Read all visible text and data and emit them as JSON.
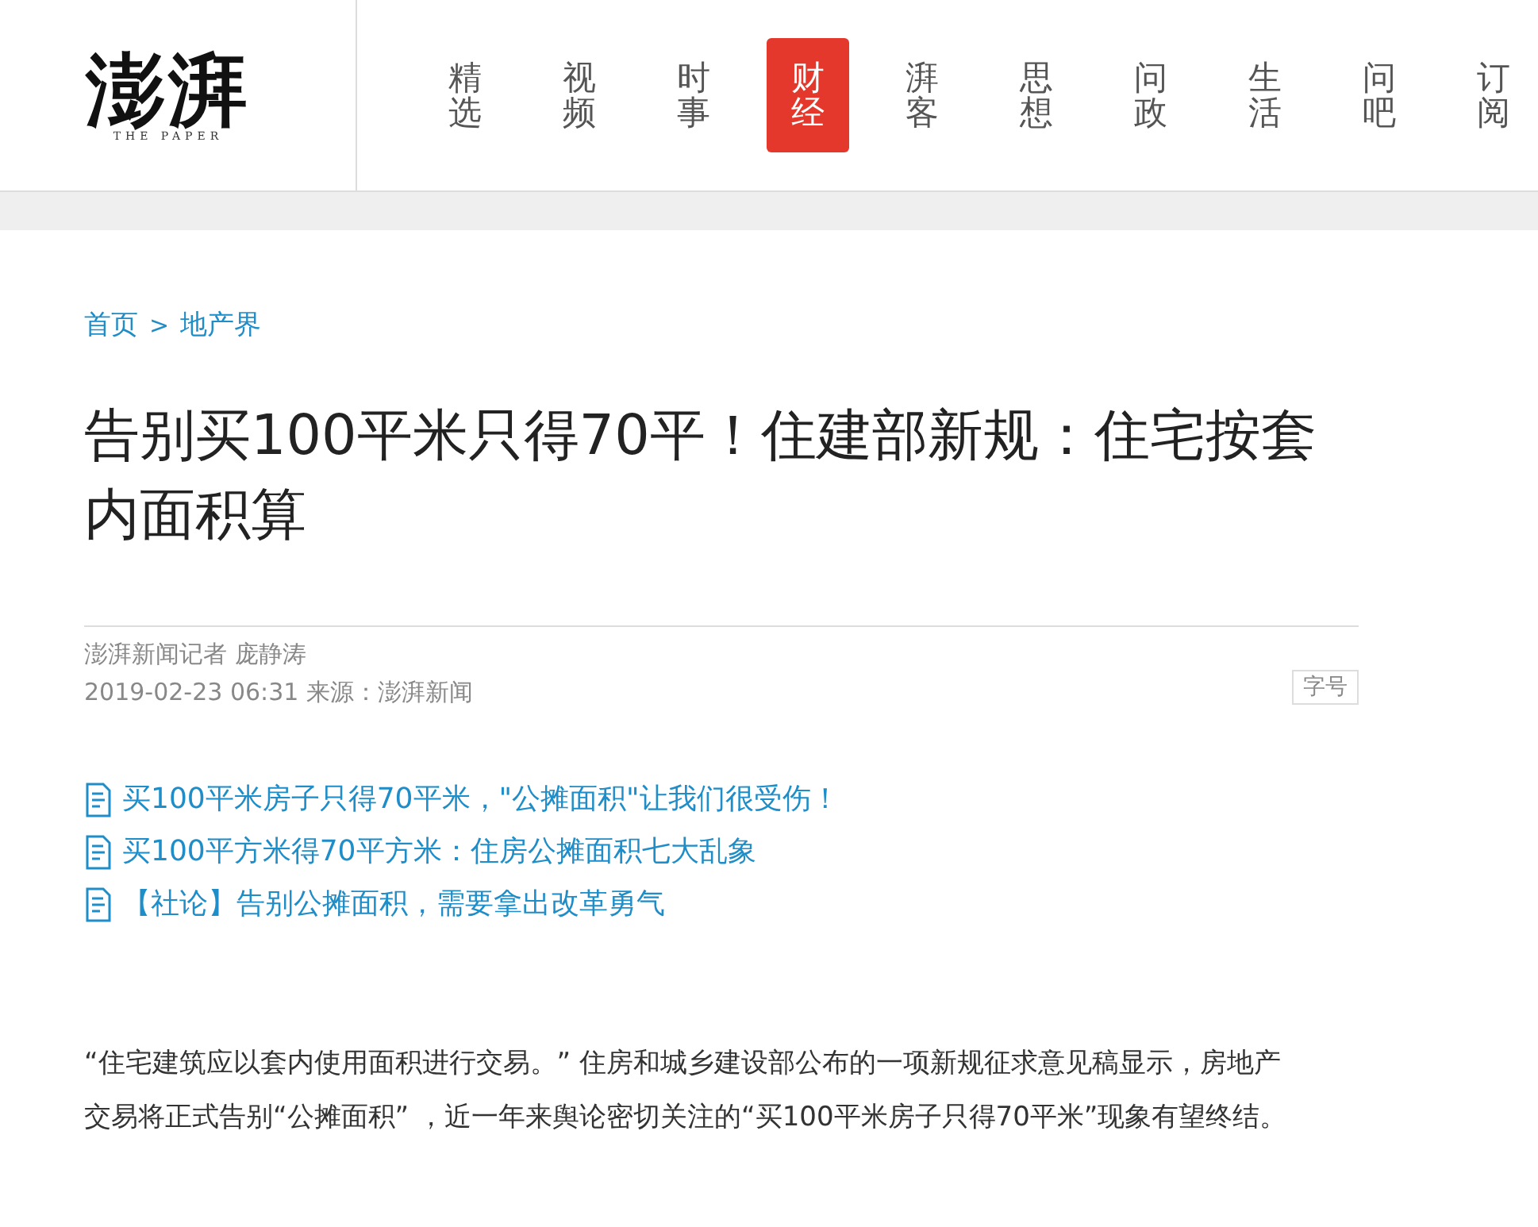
{
  "logo": {
    "name": "澎湃",
    "subtitle": "THE PAPER"
  },
  "nav": [
    {
      "label": "精选",
      "selected": false
    },
    {
      "label": "视频",
      "selected": false
    },
    {
      "label": "时事",
      "selected": false
    },
    {
      "label": "财经",
      "selected": true
    },
    {
      "label": "湃客",
      "selected": false
    },
    {
      "label": "思想",
      "selected": false
    },
    {
      "label": "问政",
      "selected": false
    },
    {
      "label": "生活",
      "selected": false
    },
    {
      "label": "问吧",
      "selected": false
    },
    {
      "label": "订阅",
      "selected": false
    }
  ],
  "breadcrumb": {
    "items": [
      "首页",
      "地产界"
    ],
    "separator": ">"
  },
  "title": "告别买100平米只得70平！住建部新规：住宅按套内面积算",
  "byline": "澎湃新闻记者 庞静涛",
  "dateline": "2019-02-23 06:31 来源：澎湃新闻",
  "font_size_button": "字号",
  "related": [
    "买100平米房子只得70平米，\"公摊面积\"让我们很受伤！",
    "买100平方米得70平方米：住房公摊面积七大乱象",
    "【社论】告别公摊面积，需要拿出改革勇气"
  ],
  "body": "“住宅建筑应以套内使用面积进行交易。” 住房和城乡建设部公布的一项新规征求意见稿显示，房地产交易将正式告别“公摊面积” ，近一年来舆论密切关注的“买100平米房子只得70平米”现象有望终结。"
}
